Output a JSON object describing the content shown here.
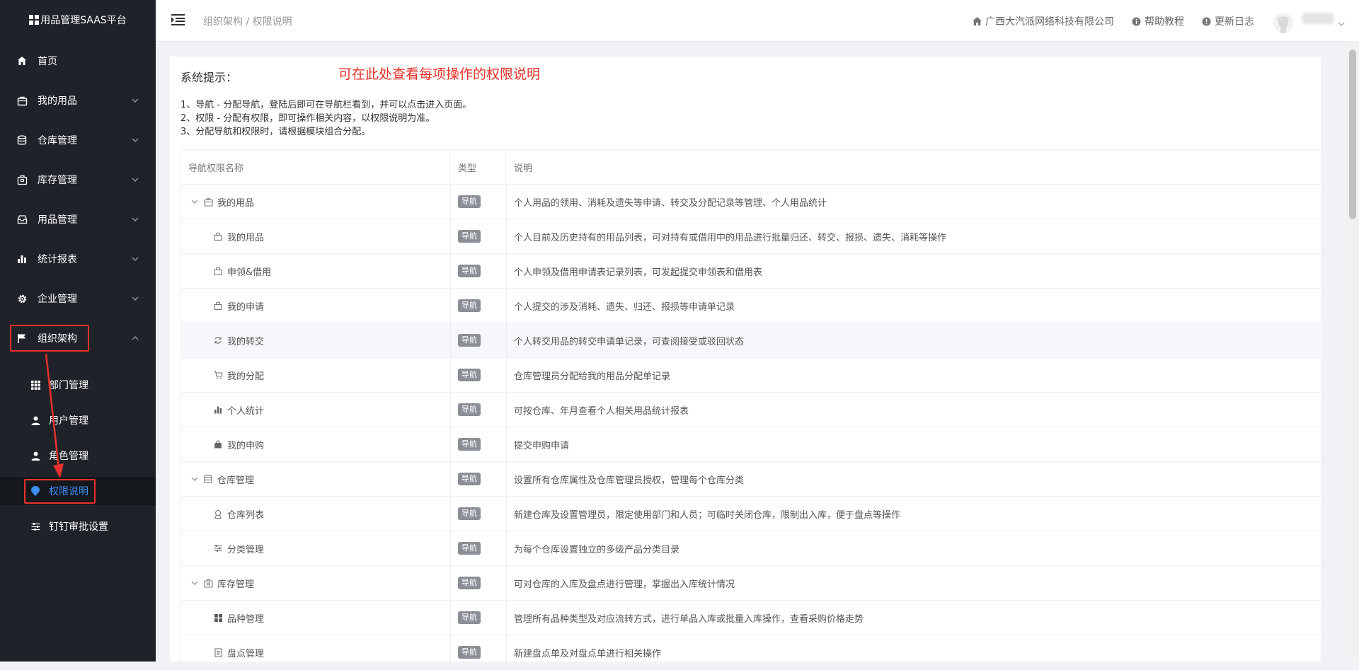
{
  "sidebar": {
    "brand": "用品管理SAAS平台",
    "menu": [
      {
        "label": "首页",
        "icon": "home-icon",
        "has_children": false
      },
      {
        "label": "我的用品",
        "icon": "bag-icon",
        "has_children": true
      },
      {
        "label": "仓库管理",
        "icon": "database-icon",
        "has_children": true
      },
      {
        "label": "库存管理",
        "icon": "inventory-icon",
        "has_children": true
      },
      {
        "label": "用品管理",
        "icon": "inbox-icon",
        "has_children": true
      },
      {
        "label": "统计报表",
        "icon": "bar-chart-icon",
        "has_children": true
      },
      {
        "label": "企业管理",
        "icon": "gear-icon",
        "has_children": true
      },
      {
        "label": "组织架构",
        "icon": "flag-icon",
        "has_children": true,
        "expanded": true
      }
    ],
    "submenu": [
      {
        "label": "部门管理",
        "icon": "grid-icon"
      },
      {
        "label": "用户管理",
        "icon": "user-icon"
      },
      {
        "label": "角色管理",
        "icon": "user-role-icon"
      },
      {
        "label": "权限说明",
        "icon": "location-pin-icon",
        "active": true
      },
      {
        "label": "钉钉审批设置",
        "icon": "sliders-icon"
      }
    ],
    "colors": {
      "background": "#1f2329",
      "active_text": "#3e8ef7",
      "annotation": "#e8322b"
    }
  },
  "header": {
    "breadcrumb": "组织架构 / 权限说明",
    "company": "广西大汽派网络科技有限公司",
    "help": "帮助教程",
    "changelog": "更新日志"
  },
  "content": {
    "tip_title": "系统提示：",
    "annotation": "可在此处查看每项操作的权限说明",
    "tips": [
      "1、导航 - 分配导航，登陆后即可在导航栏看到，并可以点击进入页面。",
      "2、权限 - 分配有权限，即可操作相关内容，以权限说明为准。",
      "3、分配导航和权限时，请根据模块组合分配。"
    ],
    "table": {
      "headers": [
        "导航权限名称",
        "类型",
        "说明"
      ],
      "rows": [
        {
          "name": "我的用品",
          "type": "导航",
          "desc": "个人用品的领用、消耗及遗失等申请、转交及分配记录等管理、个人用品统计",
          "level": 0,
          "icon": "bag-icon"
        },
        {
          "name": "我的用品",
          "type": "导航",
          "desc": "个人目前及历史持有的用品列表，可对持有或借用中的用品进行批量归还、转交、报损、遗失、消耗等操作",
          "level": 1,
          "icon": "lock-bag-icon"
        },
        {
          "name": "申领&借用",
          "type": "导航",
          "desc": "个人申领及借用申请表记录列表，可发起提交申领表和借用表",
          "level": 1,
          "icon": "lock-bag-icon"
        },
        {
          "name": "我的申请",
          "type": "导航",
          "desc": "个人提交的涉及消耗、遗失、归还、报损等申请单记录",
          "level": 1,
          "icon": "lock-bag-icon"
        },
        {
          "name": "我的转交",
          "type": "导航",
          "desc": "个人转交用品的转交申请单记录，可查阅接受或驳回状态",
          "level": 1,
          "icon": "refresh-icon",
          "highlight": true
        },
        {
          "name": "我的分配",
          "type": "导航",
          "desc": "仓库管理员分配给我的用品分配单记录",
          "level": 1,
          "icon": "cart-icon"
        },
        {
          "name": "个人统计",
          "type": "导航",
          "desc": "可按仓库、年月查看个人相关用品统计报表",
          "level": 1,
          "icon": "bar-chart-icon"
        },
        {
          "name": "我的申购",
          "type": "导航",
          "desc": "提交申购申请",
          "level": 1,
          "icon": "shopping-bag-icon"
        },
        {
          "name": "仓库管理",
          "type": "导航",
          "desc": "设置所有仓库属性及仓库管理员授权，管理每个仓库分类",
          "level": 0,
          "icon": "database-icon"
        },
        {
          "name": "仓库列表",
          "type": "导航",
          "desc": "新建仓库及设置管理员，限定使用部门和人员；可临时关闭仓库，限制出入库，便于盘点等操作",
          "level": 1,
          "icon": "warehouse-icon"
        },
        {
          "name": "分类管理",
          "type": "导航",
          "desc": "为每个仓库设置独立的多级产品分类目录",
          "level": 1,
          "icon": "sliders-icon"
        },
        {
          "name": "库存管理",
          "type": "导航",
          "desc": "可对仓库的入库及盘点进行管理，掌握出入库统计情况",
          "level": 0,
          "icon": "inventory-icon"
        },
        {
          "name": "品种管理",
          "type": "导航",
          "desc": "管理所有品种类型及对应流转方式，进行单品入库或批量入库操作，查看采购价格走势",
          "level": 1,
          "icon": "grid-icon"
        },
        {
          "name": "盘点管理",
          "type": "导航",
          "desc": "新建盘点单及对盘点单进行相关操作",
          "level": 1,
          "icon": "document-icon"
        }
      ]
    }
  }
}
